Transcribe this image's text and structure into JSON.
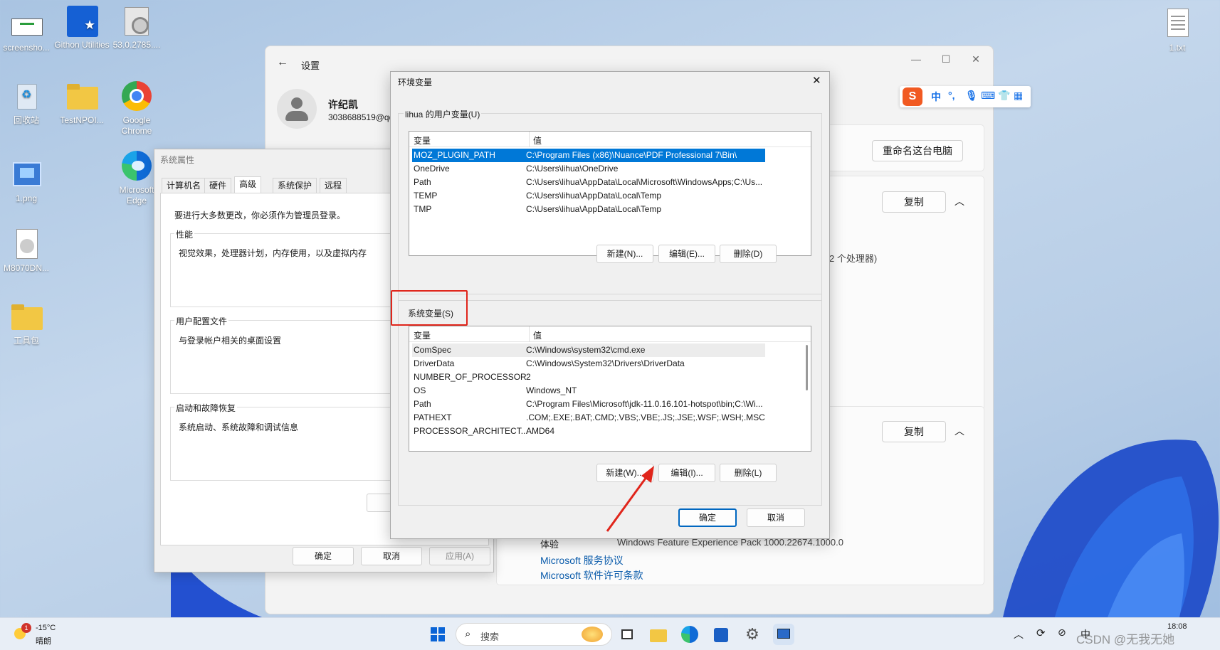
{
  "desktop": {
    "icons": [
      {
        "label": "screensho..."
      },
      {
        "label": "Githon Utilities"
      },
      {
        "label": "53.0.2785...."
      },
      {
        "label": "回收站"
      },
      {
        "label": "TestNPOI..."
      },
      {
        "label": "Google Chrome"
      },
      {
        "label": "1.png"
      },
      {
        "label": "Microsoft Edge"
      },
      {
        "label": "M8070DN..."
      },
      {
        "label": "工具包"
      },
      {
        "label": "1.txt"
      }
    ]
  },
  "settings": {
    "title": "设置",
    "user_name": "许纪凯",
    "user_email": "3038688519@qq",
    "rename_button": "重命名这台电脑",
    "copy_button_1": "复制",
    "copy_button_2": "复制",
    "processor_text": "2 个处理器)",
    "experience_label": "体验",
    "experience_value": "Windows Feature Experience Pack 1000.22674.1000.0",
    "link_service": "Microsoft 服务协议",
    "link_license": "Microsoft 软件许可条款"
  },
  "system_properties": {
    "title": "系统属性",
    "tabs": [
      {
        "label": "计算机名"
      },
      {
        "label": "硬件"
      },
      {
        "label": "高级"
      },
      {
        "label": "系统保护"
      },
      {
        "label": "远程"
      }
    ],
    "admin_note": "要进行大多数更改，你必须作为管理员登录。",
    "performance_label": "性能",
    "performance_desc": "视觉效果，处理器计划，内存使用，以及虚拟内存",
    "profile_label": "用户配置文件",
    "profile_desc": "与登录帐户相关的桌面设置",
    "startup_label": "启动和故障恢复",
    "startup_desc": "系统启动、系统故障和调试信息",
    "ok": "确定",
    "cancel": "取消",
    "apply": "应用(A)"
  },
  "env_dialog": {
    "title": "环境变量",
    "user_group_label": "lihua 的用户变量(U)",
    "col_var": "变量",
    "col_val": "值",
    "user_vars": [
      {
        "name": "MOZ_PLUGIN_PATH",
        "value": "C:\\Program Files (x86)\\Nuance\\PDF Professional 7\\Bin\\"
      },
      {
        "name": "OneDrive",
        "value": "C:\\Users\\lihua\\OneDrive"
      },
      {
        "name": "Path",
        "value": "C:\\Users\\lihua\\AppData\\Local\\Microsoft\\WindowsApps;C:\\Us..."
      },
      {
        "name": "TEMP",
        "value": "C:\\Users\\lihua\\AppData\\Local\\Temp"
      },
      {
        "name": "TMP",
        "value": "C:\\Users\\lihua\\AppData\\Local\\Temp"
      }
    ],
    "user_new": "新建(N)...",
    "user_edit": "编辑(E)...",
    "user_delete": "删除(D)",
    "system_group_label": "系统变量(S)",
    "system_vars": [
      {
        "name": "ComSpec",
        "value": "C:\\Windows\\system32\\cmd.exe"
      },
      {
        "name": "DriverData",
        "value": "C:\\Windows\\System32\\Drivers\\DriverData"
      },
      {
        "name": "NUMBER_OF_PROCESSORS",
        "value": "2"
      },
      {
        "name": "OS",
        "value": "Windows_NT"
      },
      {
        "name": "Path",
        "value": "C:\\Program Files\\Microsoft\\jdk-11.0.16.101-hotspot\\bin;C:\\Wi..."
      },
      {
        "name": "PATHEXT",
        "value": ".COM;.EXE;.BAT;.CMD;.VBS;.VBE;.JS;.JSE;.WSF;.WSH;.MSC"
      },
      {
        "name": "PROCESSOR_ARCHITECT...",
        "value": "AMD64"
      }
    ],
    "sys_new": "新建(W)...",
    "sys_edit": "编辑(I)...",
    "sys_delete": "删除(L)",
    "ok": "确定",
    "cancel": "取消"
  },
  "ime": {
    "mode": "中"
  },
  "taskbar": {
    "weather_temp": "-15°C",
    "weather_desc": "晴朗",
    "weather_badge": "1",
    "search_placeholder": "搜索",
    "tray_lang": "中",
    "clock_time": "18:08",
    "watermark": "CSDN @无我无她"
  },
  "colors": {
    "accent": "#0078d7",
    "highlight_box": "#e0251b"
  }
}
